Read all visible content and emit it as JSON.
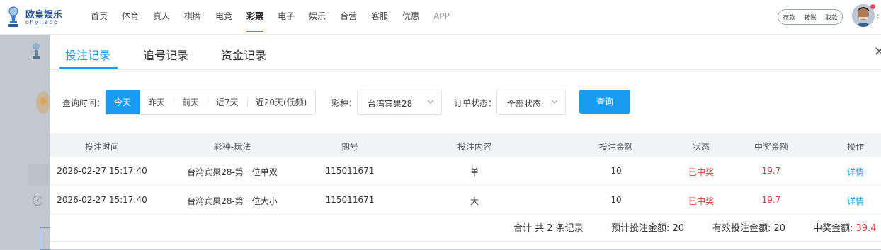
{
  "brand": {
    "name": "欧皇娱乐",
    "sub": "ohyl.app"
  },
  "nav": {
    "items": [
      {
        "label": "首页"
      },
      {
        "label": "体育"
      },
      {
        "label": "真人"
      },
      {
        "label": "棋牌"
      },
      {
        "label": "电竞"
      },
      {
        "label": "彩票",
        "active": true
      },
      {
        "label": "电子"
      },
      {
        "label": "娱乐"
      },
      {
        "label": "合营"
      },
      {
        "label": "客服"
      },
      {
        "label": "优惠"
      },
      {
        "label": "APP",
        "muted": true
      }
    ],
    "quick": [
      "存款",
      "转账",
      "取款"
    ]
  },
  "modal": {
    "tabs": [
      "投注记录",
      "追号记录",
      "资金记录"
    ],
    "filters": {
      "time_label": "查询时间：",
      "time_options": [
        "今天",
        "昨天",
        "前天",
        "近7天",
        "近20天(低频)"
      ],
      "time_selected": "今天",
      "lottery_label": "彩种：",
      "lottery_value": "台湾宾果28",
      "status_label": "订单状态：",
      "status_value": "全部状态",
      "query_label": "查询"
    },
    "table": {
      "headers": [
        "投注时间",
        "彩种-玩法",
        "期号",
        "投注内容",
        "投注金额",
        "状态",
        "中奖金额",
        "操作"
      ],
      "rows": [
        {
          "time": "2026-02-27 15:17:40",
          "game": "台湾宾果28-第一位单双",
          "issue": "115011671",
          "content": "单",
          "amount": "10",
          "status": "已中奖",
          "win": "19.7",
          "op": "详情"
        },
        {
          "time": "2026-02-27 15:17:40",
          "game": "台湾宾果28-第一位大小",
          "issue": "115011671",
          "content": "大",
          "amount": "10",
          "status": "已中奖",
          "win": "19.7",
          "op": "详情"
        }
      ]
    },
    "summary": {
      "count_text": "合计 共 2 条记录",
      "expected_label": "预计投注金额: ",
      "expected_value": "20",
      "valid_label": "有效投注金额: ",
      "valid_value": "20",
      "win_label": "中奖金额: ",
      "win_value": "39.4"
    }
  },
  "colors": {
    "accent": "#1a9bf0",
    "win_red": "#e23b3b"
  }
}
